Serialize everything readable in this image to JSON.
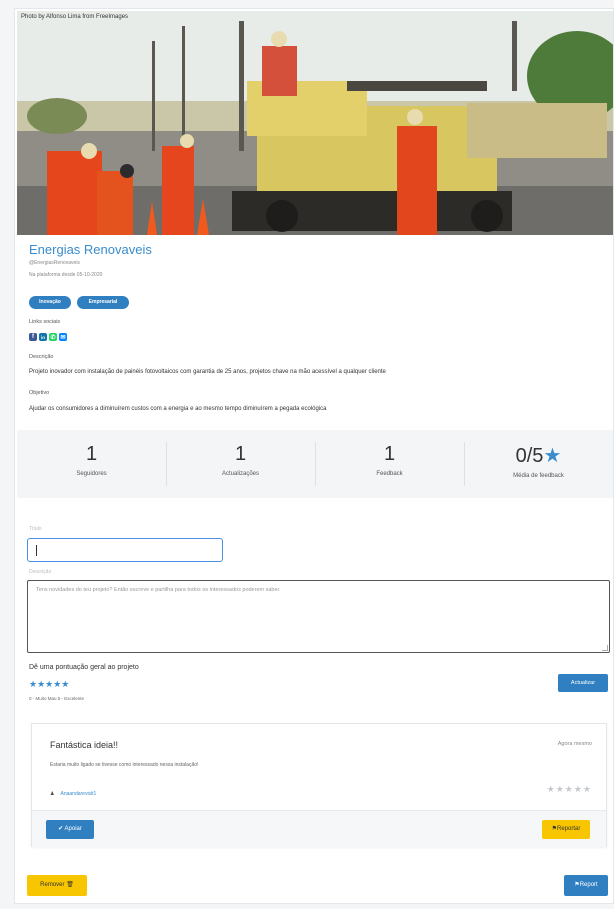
{
  "hero": {
    "alt_text": "Photo by Alfonso Lima from FreeImages"
  },
  "project": {
    "title": "Energias Renovaveis",
    "handle": "@EnergiasRenovaveis",
    "member_since": "Na plataforma desde 05-10-2020",
    "badges": [
      "Inovação",
      "Empresarial"
    ],
    "social_label": "Links sociais",
    "socials": [
      {
        "icon": "facebook-icon",
        "glyph": "f",
        "color": "#3b5998"
      },
      {
        "icon": "linkedin-icon",
        "glyph": "in",
        "color": "#0e76a8"
      },
      {
        "icon": "whatsapp-icon",
        "glyph": "✆",
        "color": "#25d366"
      },
      {
        "icon": "messenger-icon",
        "glyph": "✉",
        "color": "#0084ff"
      }
    ],
    "description_label": "Descrição",
    "description": "Projeto inovador com instalação de painéis fotovoltaicos com garantia de 25 anos, projetos chave na mão acessível a qualquer cliente",
    "objective_label": "Objetivo",
    "objective": "Ajudar os consumidores a diminuírem custos com a energia e ao mesmo tempo diminuírem a pegada ecológica"
  },
  "stats": [
    {
      "value": "1",
      "label": "Seguidores"
    },
    {
      "value": "1",
      "label": "Actualizações"
    },
    {
      "value": "1",
      "label": "Feedback"
    },
    {
      "value": "0/5",
      "label": "Média de feedback",
      "icon": "star-icon"
    }
  ],
  "form": {
    "title_label": "Título",
    "title_value": "",
    "description_label": "Descrição",
    "description_placeholder": "Tens novidades do teu projeto? Então escreve e partilha para todos os interessados poderem saber.",
    "rating_label": "Dê uma pontuação geral ao projeto",
    "rating_stars": "★★★★★",
    "rating_info": "0 - Muito Mau 5 - Excelente",
    "submit_label": "Actualizar"
  },
  "feedback": {
    "title": "Fantástica ideia!!",
    "time": "Agora mesmo",
    "text": "Estaria muito ligado se tivesse como interessado nessa instalação!",
    "user": "Anaandarevisit1",
    "stars": "★★★★★",
    "support_label": "Apoiar",
    "report_label": "Reportar"
  },
  "footer": {
    "remove_label": "Remover",
    "report_label": "Report"
  }
}
